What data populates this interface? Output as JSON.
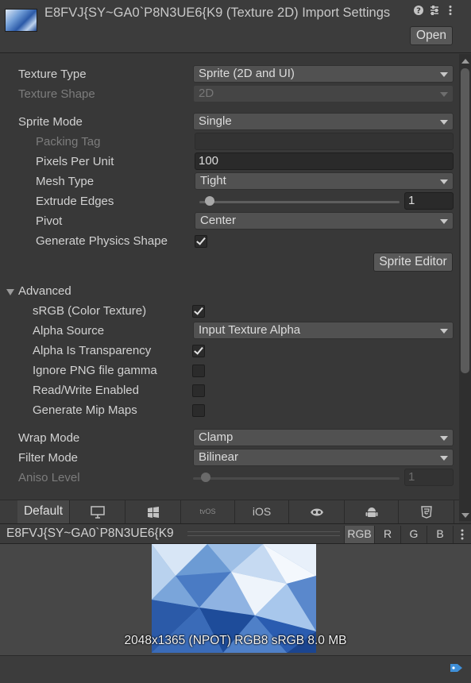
{
  "header": {
    "title": "E8FVJ{SY~GA0`P8N3UE6{K9 (Texture 2D) Import Settings",
    "open_label": "Open",
    "icons": [
      "help-icon",
      "preset-icon",
      "kebab-menu-icon"
    ]
  },
  "fields": {
    "texture_type": {
      "label": "Texture Type",
      "value": "Sprite (2D and UI)"
    },
    "texture_shape": {
      "label": "Texture Shape",
      "value": "2D"
    },
    "sprite_mode": {
      "label": "Sprite Mode",
      "value": "Single"
    },
    "packing_tag": {
      "label": "Packing Tag",
      "value": ""
    },
    "pixels_per_unit": {
      "label": "Pixels Per Unit",
      "value": "100"
    },
    "mesh_type": {
      "label": "Mesh Type",
      "value": "Tight"
    },
    "extrude_edges": {
      "label": "Extrude Edges",
      "value": "1",
      "slider_fraction": 0.05
    },
    "pivot": {
      "label": "Pivot",
      "value": "Center"
    },
    "generate_physics_shape": {
      "label": "Generate Physics Shape",
      "checked": true
    },
    "sprite_editor_label": "Sprite Editor"
  },
  "advanced": {
    "label": "Advanced",
    "srgb": {
      "label": "sRGB (Color Texture)",
      "checked": true
    },
    "alpha_source": {
      "label": "Alpha Source",
      "value": "Input Texture Alpha"
    },
    "alpha_is_transparency": {
      "label": "Alpha Is Transparency",
      "checked": true
    },
    "ignore_png_gamma": {
      "label": "Ignore PNG file gamma",
      "checked": false
    },
    "read_write": {
      "label": "Read/Write Enabled",
      "checked": false
    },
    "generate_mip_maps": {
      "label": "Generate Mip Maps",
      "checked": false
    }
  },
  "wrap_mode": {
    "label": "Wrap Mode",
    "value": "Clamp"
  },
  "filter_mode": {
    "label": "Filter Mode",
    "value": "Bilinear"
  },
  "aniso_level": {
    "label": "Aniso Level",
    "value": "1",
    "slider_fraction": 0.06
  },
  "platform_tabs": [
    {
      "label": "Default",
      "icon": null,
      "active": true
    },
    {
      "label": "",
      "icon": "monitor-icon"
    },
    {
      "label": "",
      "icon": "windows-icon"
    },
    {
      "label": "tvOS",
      "icon": null
    },
    {
      "label": "iOS",
      "icon": null
    },
    {
      "label": "",
      "icon": "webgl-icon"
    },
    {
      "label": "",
      "icon": "android-icon"
    },
    {
      "label": "",
      "icon": "html5-icon"
    }
  ],
  "preview": {
    "name": "E8FVJ{SY~GA0`P8N3UE6{K9",
    "channels": [
      "RGB",
      "R",
      "G",
      "B"
    ],
    "active_channel": "RGB",
    "info": "2048x1365 (NPOT)  RGB8 sRGB   8.0 MB"
  },
  "colors": {
    "background": "#383838",
    "field": "#515151",
    "text": "#d2d2d2",
    "dim_text": "#7c7c7c"
  }
}
